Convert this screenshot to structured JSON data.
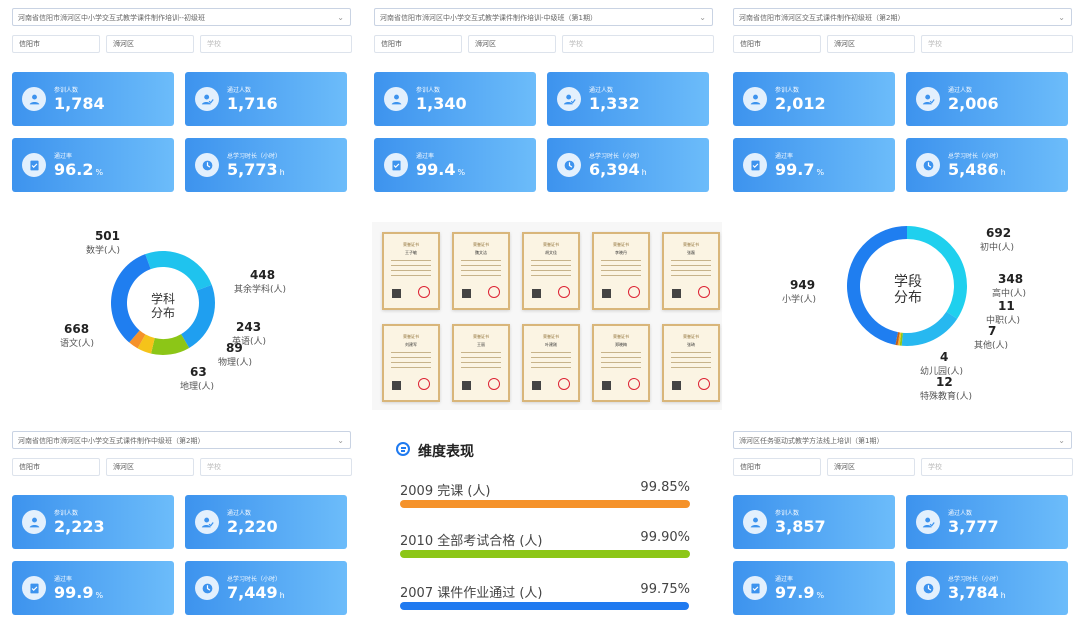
{
  "colors": {
    "card_start": "#3d93ee",
    "card_end": "#6cbcfa",
    "bar_orange": "#f5922a",
    "bar_green": "#8cc617",
    "bar_blue": "#1f7af0",
    "donut_blue": "#1f7ef0",
    "donut_cyan": "#1fd0ee"
  },
  "panels": [
    {
      "select": "河南省信阳市浉河区中小学交互式教学课件制作培训--初级班",
      "city": "信阳市",
      "district": "浉河区",
      "school_placeholder": "学校",
      "cards": [
        {
          "label": "参训人数",
          "value": "1,784",
          "unit": ""
        },
        {
          "label": "通过人数",
          "value": "1,716",
          "unit": ""
        },
        {
          "label": "通过率",
          "value": "96.2",
          "unit": "%"
        },
        {
          "label": "总学习时长（小时）",
          "value": "5,773",
          "unit": "h"
        }
      ]
    },
    {
      "select": "河南省信阳市浉河区中小学交互式教学课件制作培训-中级班（第1期）",
      "city": "信阳市",
      "district": "浉河区",
      "school_placeholder": "学校",
      "cards": [
        {
          "label": "参训人数",
          "value": "1,340",
          "unit": ""
        },
        {
          "label": "通过人数",
          "value": "1,332",
          "unit": ""
        },
        {
          "label": "通过率",
          "value": "99.4",
          "unit": "%"
        },
        {
          "label": "总学习时长（小时）",
          "value": "6,394",
          "unit": "h"
        }
      ]
    },
    {
      "select": "河南省信阳市浉河区交互式课件制作初级班（第2期）",
      "city": "信阳市",
      "district": "浉河区",
      "school_placeholder": "学校",
      "cards": [
        {
          "label": "参训人数",
          "value": "2,012",
          "unit": ""
        },
        {
          "label": "通过人数",
          "value": "2,006",
          "unit": ""
        },
        {
          "label": "通过率",
          "value": "99.7",
          "unit": "%"
        },
        {
          "label": "总学习时长（小时）",
          "value": "5,486",
          "unit": "h"
        }
      ]
    },
    {
      "select": "河南省信阳市浉河区中小学交互式课件制作中级班（第2期）",
      "city": "信阳市",
      "district": "浉河区",
      "school_placeholder": "学校",
      "cards": [
        {
          "label": "参训人数",
          "value": "2,223",
          "unit": ""
        },
        {
          "label": "通过人数",
          "value": "2,220",
          "unit": ""
        },
        {
          "label": "通过率",
          "value": "99.9",
          "unit": "%"
        },
        {
          "label": "总学习时长（小时）",
          "value": "7,449",
          "unit": "h"
        }
      ]
    },
    {
      "select": "浉河区任务驱动式教学方法线上培训（第1期）",
      "city": "信阳市",
      "district": "浉河区",
      "school_placeholder": "学校",
      "cards": [
        {
          "label": "参训人数",
          "value": "3,857",
          "unit": ""
        },
        {
          "label": "通过人数",
          "value": "3,777",
          "unit": ""
        },
        {
          "label": "通过率",
          "value": "97.9",
          "unit": "%"
        },
        {
          "label": "总学习时长（小时）",
          "value": "3,784",
          "unit": "h"
        }
      ]
    }
  ],
  "chart_data": [
    {
      "type": "pie",
      "title": "学科分布",
      "slices": [
        {
          "label": "数学(人)",
          "value": 501,
          "color": "#1fc3ee"
        },
        {
          "label": "其余学科(人)",
          "value": 448,
          "color": "#1f9ff0"
        },
        {
          "label": "英语(人)",
          "value": 243,
          "color": "#8cc617"
        },
        {
          "label": "物理(人)",
          "value": 89,
          "color": "#f5c31a"
        },
        {
          "label": "地理(人)",
          "value": 63,
          "color": "#f5922a"
        },
        {
          "label": "语文(人)",
          "value": 668,
          "color": "#1f7ef0"
        }
      ]
    },
    {
      "type": "pie",
      "title": "学段分布",
      "slices": [
        {
          "label": "初中(人)",
          "value": 692,
          "color": "#1fd0ee"
        },
        {
          "label": "高中(人)",
          "value": 348,
          "color": "#27b8f0"
        },
        {
          "label": "中职(人)",
          "value": 11,
          "color": "#8cc617"
        },
        {
          "label": "其他(人)",
          "value": 7,
          "color": "#f5c31a"
        },
        {
          "label": "幼儿园(人)",
          "value": 4,
          "color": "#f5922a"
        },
        {
          "label": "特殊教育(人)",
          "value": 12,
          "color": "#c2611a"
        },
        {
          "label": "小学(人)",
          "value": 949,
          "color": "#1f7ef0"
        }
      ]
    }
  ],
  "donut1": {
    "center_line1": "学科",
    "center_line2": "分布",
    "labels": [
      {
        "num": "501",
        "txt": "数学(人)"
      },
      {
        "num": "448",
        "txt": "其余学科(人)"
      },
      {
        "num": "243",
        "txt": "英语(人)"
      },
      {
        "num": "89",
        "txt": "物理(人)"
      },
      {
        "num": "63",
        "txt": "地理(人)"
      },
      {
        "num": "668",
        "txt": "语文(人)"
      }
    ]
  },
  "donut2": {
    "center_line1": "学段",
    "center_line2": "分布",
    "labels": [
      {
        "num": "692",
        "txt": "初中(人)"
      },
      {
        "num": "348",
        "txt": "高中(人)"
      },
      {
        "num": "11",
        "txt": "中职(人)"
      },
      {
        "num": "7",
        "txt": "其他(人)"
      },
      {
        "num": "4",
        "txt": "幼儿园(人)"
      },
      {
        "num": "12",
        "txt": "特殊教育(人)"
      },
      {
        "num": "949",
        "txt": "小学(人)"
      }
    ]
  },
  "certificates": {
    "title": "荣誉证书",
    "names": [
      "王子敏",
      "魏文洁",
      "胡文佳",
      "李晓丹",
      "张磊",
      "刘建军",
      "王丽",
      "叶建刚",
      "郑晓梅",
      "张琦"
    ]
  },
  "dimension": {
    "title": "维度表现",
    "rows": [
      {
        "label": "2009 完课 (人)",
        "pct": "99.85%",
        "ratio": 0.9985,
        "color": "#f5922a"
      },
      {
        "label": "2010 全部考试合格 (人)",
        "pct": "99.90%",
        "ratio": 0.999,
        "color": "#8cc617"
      },
      {
        "label": "2007 课件作业通过 (人)",
        "pct": "99.75%",
        "ratio": 0.9975,
        "color": "#1f7af0"
      }
    ]
  }
}
